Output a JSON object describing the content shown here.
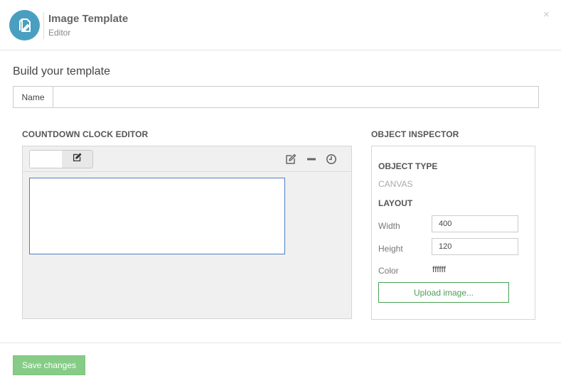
{
  "header": {
    "title": "Image Template",
    "subtitle": "Editor",
    "close_label": "×",
    "app_icon": "edit-document-icon",
    "accent_color": "#4a9fc1"
  },
  "form": {
    "heading": "Build your template",
    "name_label": "Name",
    "name_value": "",
    "name_placeholder": ""
  },
  "editor": {
    "title": "COUNTDOWN CLOCK EDITOR",
    "tabs": [
      {
        "name": "blank-tab",
        "label": ""
      },
      {
        "name": "edit-tab",
        "icon": "edit-icon"
      }
    ],
    "tools": [
      "edit-icon",
      "minus-icon",
      "clock-icon"
    ],
    "canvas_border_color": "#4a7fc1"
  },
  "inspector": {
    "title": "OBJECT INSPECTOR",
    "object_type_heading": "OBJECT TYPE",
    "object_type_value": "CANVAS",
    "layout_heading": "LAYOUT",
    "width_label": "Width",
    "width_value": "400",
    "height_label": "Height",
    "height_value": "120",
    "color_label": "Color",
    "color_value": "ffffff",
    "upload_label": "Upload image...",
    "upload_color": "#4aa052"
  },
  "footer": {
    "save_label": "Save changes",
    "save_color": "#86cc86"
  }
}
